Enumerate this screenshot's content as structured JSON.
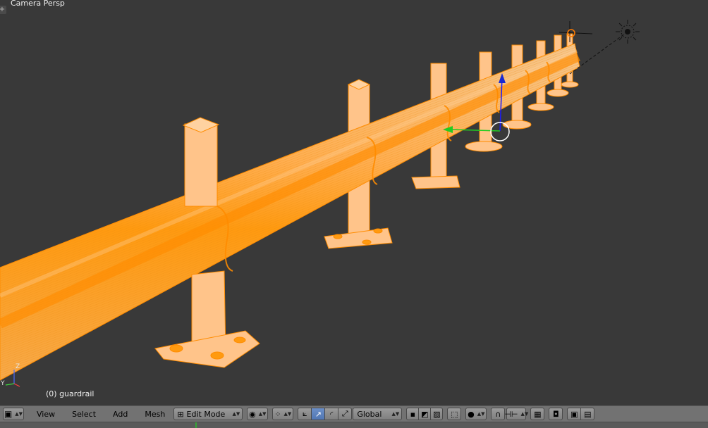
{
  "viewport": {
    "view_name": "Camera Persp",
    "object_info": "(0) guardrail",
    "axis_labels": {
      "z": "Z",
      "y": "Y"
    }
  },
  "colors": {
    "background": "#393939",
    "selection": "#ff9a10",
    "selection_fill": "#ffb366",
    "header": "#727272",
    "active_button": "#5177b4"
  },
  "header": {
    "menus": [
      "View",
      "Select",
      "Add",
      "Mesh"
    ],
    "mode": "Edit Mode",
    "orientation": "Global",
    "icons": {
      "editor_type": "cube-icon",
      "shading": "solid-sphere-icon",
      "pivot": "pivot-icon",
      "manipulator": "manipulator-axis-icon",
      "translate": "translate-arrow-icon",
      "rotate": "rotate-arc-icon",
      "scale": "scale-icon",
      "select_vertex": "vertex-select-icon",
      "select_edge": "edge-select-icon",
      "select_face": "face-select-icon",
      "limit_visible": "occlude-icon",
      "proportional": "proportional-icon",
      "snap": "magnet-icon",
      "snap_element": "snap-element-icon",
      "render_preview": "render-icon",
      "camera": "camera-icon",
      "clapper": "clapperboard-icon"
    }
  }
}
